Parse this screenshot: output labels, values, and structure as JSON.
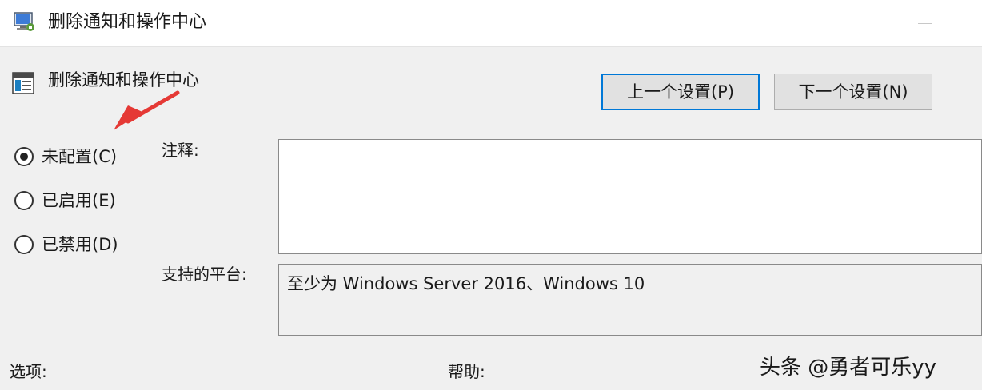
{
  "window": {
    "title": "删除通知和操作中心"
  },
  "header": {
    "policy_name": "删除通知和操作中心",
    "prev_button": "上一个设置(P)",
    "next_button": "下一个设置(N)"
  },
  "state_options": [
    {
      "label": "未配置(C)",
      "checked": true
    },
    {
      "label": "已启用(E)",
      "checked": false
    },
    {
      "label": "已禁用(D)",
      "checked": false
    }
  ],
  "comment": {
    "label": "注释:",
    "value": ""
  },
  "platform": {
    "label": "支持的平台:",
    "value": "至少为 Windows Server 2016、Windows 10"
  },
  "bottom": {
    "options_label": "选项:",
    "help_label": "帮助:"
  },
  "watermark": "头条 @勇者可乐yy",
  "colors": {
    "focus_border": "#0078d7",
    "annotation_arrow": "#e53935"
  },
  "icons": {
    "title_icon": "group-policy-icon",
    "policy_icon": "policy-setting-icon"
  }
}
